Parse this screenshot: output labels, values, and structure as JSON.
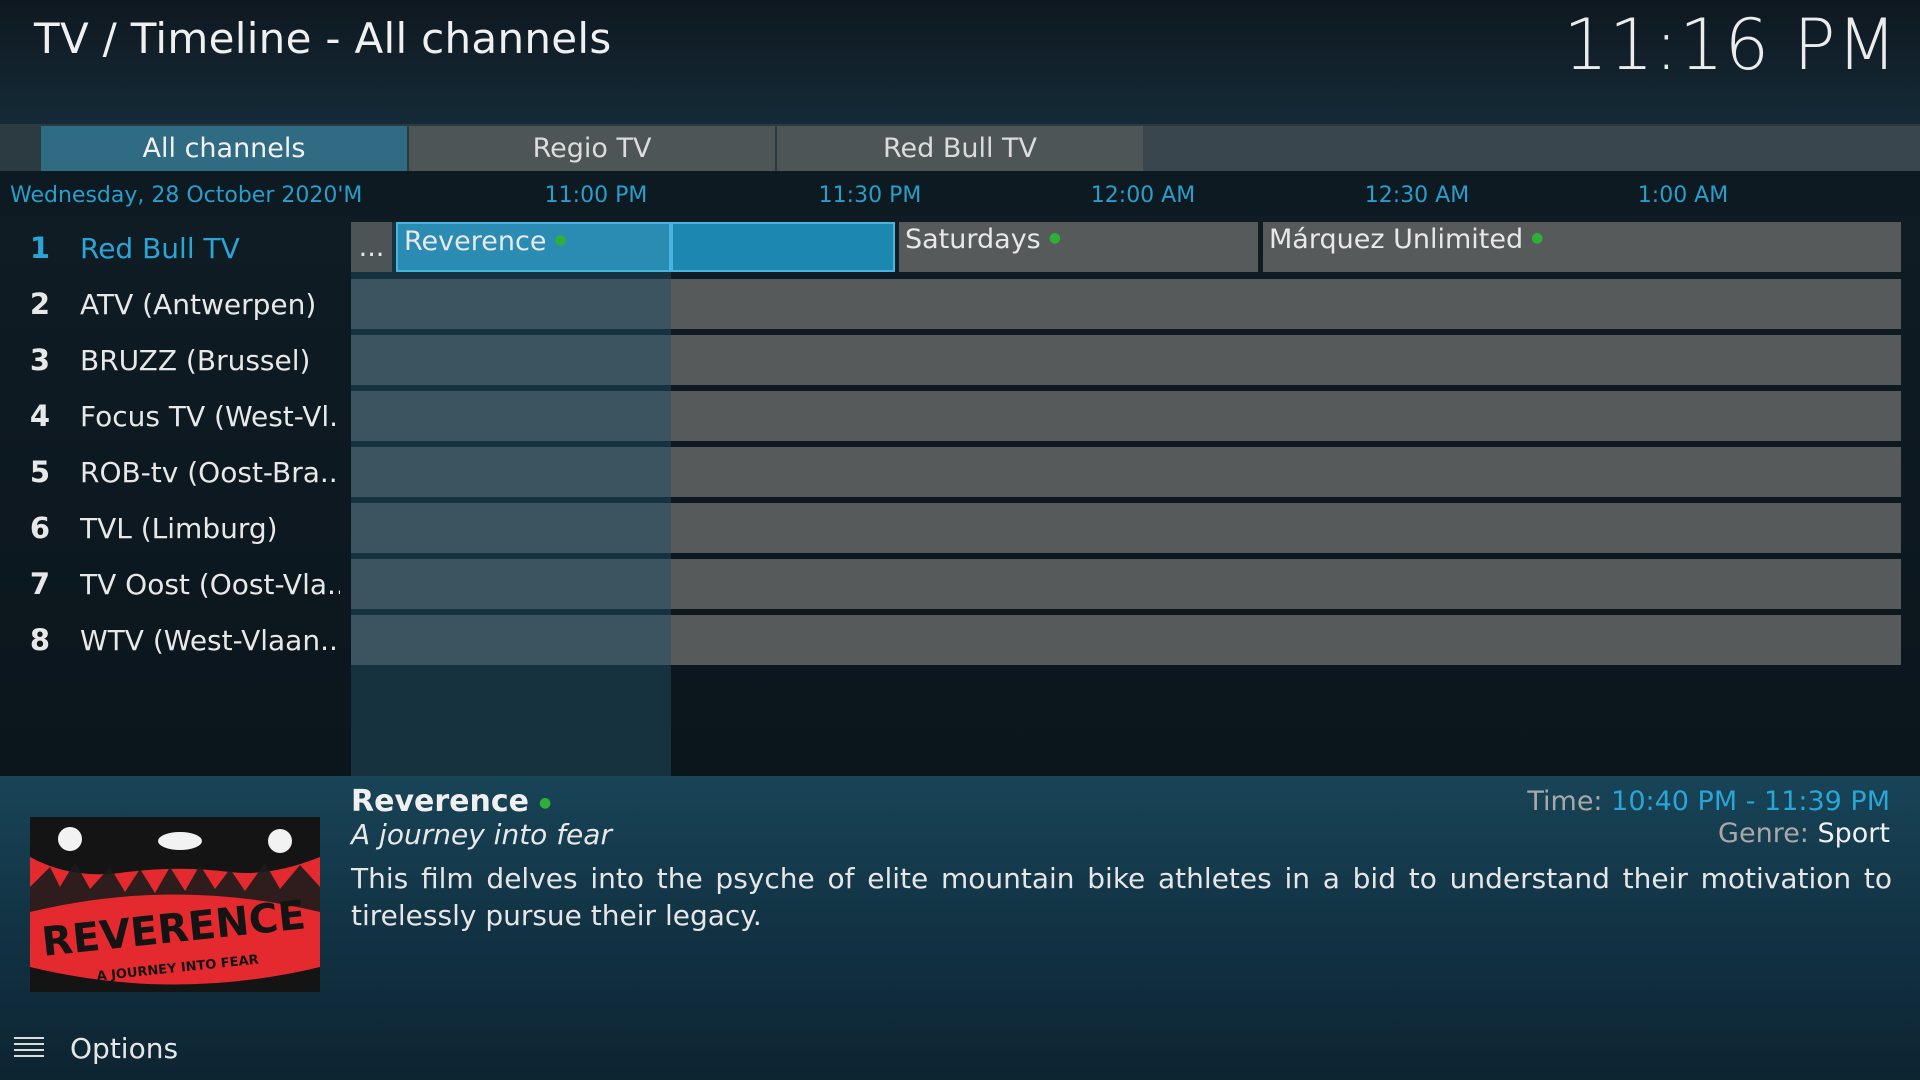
{
  "header": {
    "title": "TV / Timeline - All channels",
    "clock": "11:16 PM"
  },
  "tabs": [
    {
      "label": "All channels",
      "active": true
    },
    {
      "label": "Regio TV",
      "active": false
    },
    {
      "label": "Red Bull TV",
      "active": false
    }
  ],
  "timeline": {
    "date": "Wednesday, 28 October 2020'M",
    "slots": [
      "11:00 PM",
      "11:30 PM",
      "12:00 AM",
      "12:30 AM",
      "1:00 AM"
    ]
  },
  "channels": [
    {
      "number": "1",
      "name": "Red Bull TV"
    },
    {
      "number": "2",
      "name": "ATV (Antwerpen)"
    },
    {
      "number": "3",
      "name": "BRUZZ (Brussel)"
    },
    {
      "number": "4",
      "name": "Focus TV (West-Vl..."
    },
    {
      "number": "5",
      "name": "ROB-tv (Oost-Bra..."
    },
    {
      "number": "6",
      "name": "TVL (Limburg)"
    },
    {
      "number": "7",
      "name": "TV Oost (Oost-Vla..."
    },
    {
      "number": "8",
      "name": "WTV (West-Vlaan..."
    }
  ],
  "programmes": {
    "more": "...",
    "reverence": "Reverence",
    "saturdays": "Saturdays",
    "marquez": "Márquez Unlimited"
  },
  "info": {
    "title": "Reverence",
    "subtitle": "A journey into fear",
    "description": "This film delves into the psyche of elite mountain bike athletes in a bid to understand their motivation to tirelessly pursue their legacy.",
    "time_label": "Time:",
    "time_value": "10:40 PM - 11:39 PM",
    "genre_label": "Genre:",
    "genre_value": "Sport",
    "poster_title": "REVERENCE",
    "poster_subtitle": "A JOURNEY INTO FEAR"
  },
  "footer": {
    "options_label": "Options"
  },
  "colors": {
    "accent": "#2aa5d6",
    "tab_active": "#2f6b82",
    "focus": "#2a8cb3",
    "airing_dot": "#2fae3a"
  }
}
